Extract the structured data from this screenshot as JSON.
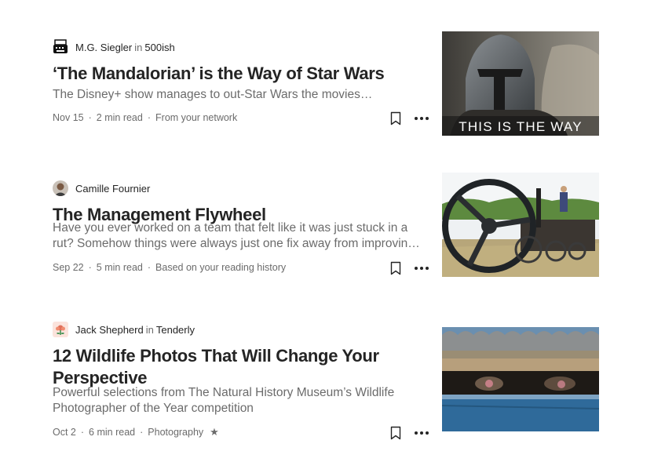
{
  "articles": [
    {
      "author": "M.G. Siegler",
      "in_word": "in",
      "publication": "500ish",
      "title": "‘The Mandalorian’ is the Way of Star Wars",
      "excerpt": "The Disney+ show manages to out-Star Wars the movies…",
      "date": "Nov 15",
      "read_time": "2 min read",
      "tag": "From your network",
      "thumbnail_caption": "THIS IS THE WAY",
      "avatar_icon": "typewriter-icon"
    },
    {
      "author": "Camille Fournier",
      "title": "The Management Flywheel",
      "excerpt": "Have you ever worked on a team that felt like it was just stuck in a rut? Somehow things were always just one fix away from improvin…",
      "date": "Sep 22",
      "read_time": "5 min read",
      "tag": "Based on your reading history",
      "avatar_icon": "person-avatar"
    },
    {
      "author": "Jack Shepherd",
      "in_word": "in",
      "publication": "Tenderly",
      "title": "12 Wildlife Photos That Will Change Your Perspective",
      "excerpt": "Powerful selections from The Natural History Museum’s Wildlife Photographer of the Year competition",
      "date": "Oct 2",
      "read_time": "6 min read",
      "tag": "Photography",
      "member_star": "★",
      "avatar_icon": "flower-icon"
    }
  ],
  "icons": {
    "bookmark": "bookmark-icon",
    "more": "more-options-icon"
  },
  "colors": {
    "text_primary": "#242424",
    "text_secondary": "#6b6b6b",
    "background": "#ffffff"
  }
}
